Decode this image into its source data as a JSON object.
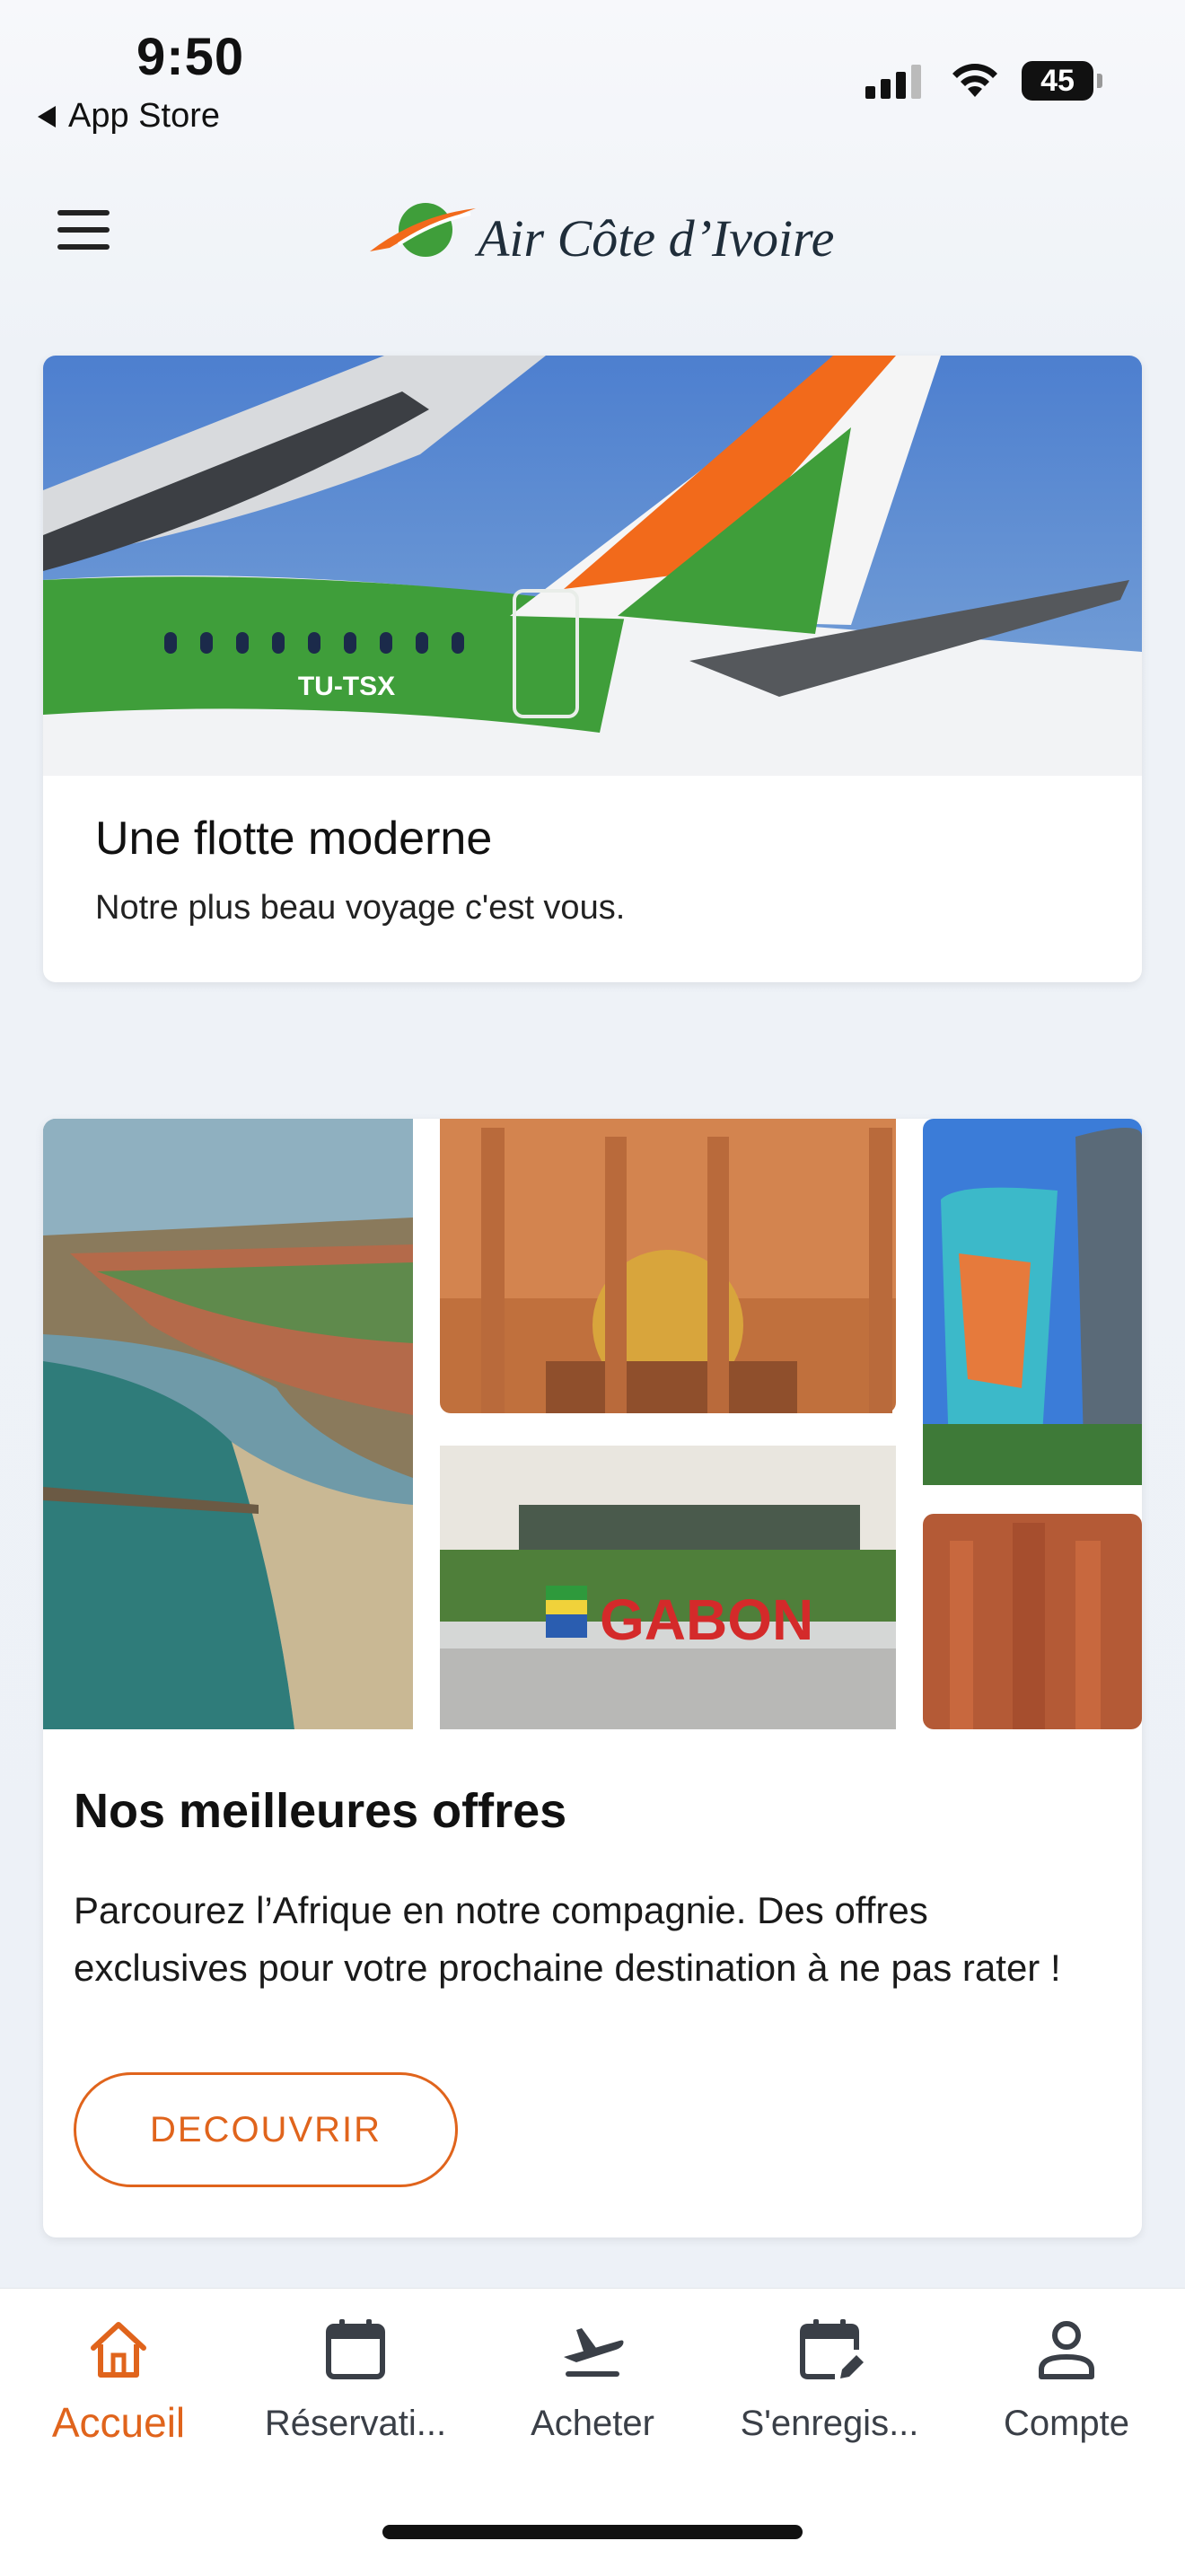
{
  "status_bar": {
    "time": "9:50",
    "back_label": "App Store",
    "battery": "45"
  },
  "header": {
    "logo_text": "Air Côte d’Ivoire"
  },
  "fleet_card": {
    "title": "Une flotte moderne",
    "subtitle": "Notre plus beau voyage c'est vous.",
    "aircraft_registration": "TU-TSX"
  },
  "offers_card": {
    "title": "Nos meilleures offres",
    "description": "Parcourez l’Afrique en notre compagnie. Des offres exclusives pour votre prochaine destination à ne pas rater !",
    "button_label": "DECOUVRIR",
    "sign_text": "GABON"
  },
  "tabbar": {
    "items": [
      {
        "label": "Accueil",
        "icon": "home-icon",
        "active": true
      },
      {
        "label": "Réservati...",
        "icon": "calendar-icon",
        "active": false
      },
      {
        "label": "Acheter",
        "icon": "plane-departure-icon",
        "active": false
      },
      {
        "label": "S'enregis...",
        "icon": "calendar-edit-icon",
        "active": false
      },
      {
        "label": "Compte",
        "icon": "user-icon",
        "active": false
      }
    ]
  },
  "colors": {
    "accent": "#e0641c",
    "brand_green": "#3f9e3a",
    "brand_orange": "#f26a1b",
    "text": "#111111"
  }
}
